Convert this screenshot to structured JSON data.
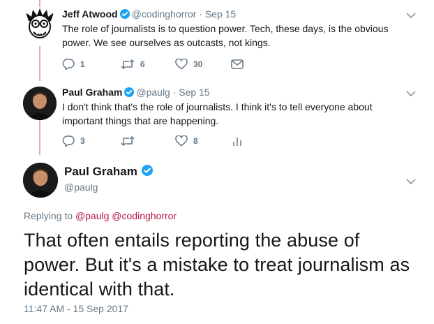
{
  "tweets": [
    {
      "name": "Jeff Atwood",
      "handle": "@codinghorror",
      "date": "· Sep 15",
      "text": "The role of journalists is to question power. Tech, these days, is the obvious power. We see ourselves as outcasts, not kings.",
      "replies": "1",
      "retweets": "6",
      "likes": "30"
    },
    {
      "name": "Paul Graham",
      "handle": "@paulg",
      "date": "· Sep 15",
      "text": "I don't think that's the role of journalists. I think it's to tell everyone about important things that are happening.",
      "replies": "3",
      "retweets": "",
      "likes": "8"
    }
  ],
  "main_tweet": {
    "name": "Paul Graham",
    "handle": "@paulg",
    "replying_label": "Replying to",
    "mention_1": "@paulg",
    "mention_2": "@codinghorror",
    "text": "That often entails reporting the abuse of power. But it's a mistake to treat journalism as identical with that.",
    "timestamp": "11:47 AM - 15 Sep 2017"
  },
  "colors": {
    "thread_line": "#e1aeb5",
    "verified": "#1da1f2",
    "mention": "#b4183f",
    "secondary_text": "#657786"
  }
}
